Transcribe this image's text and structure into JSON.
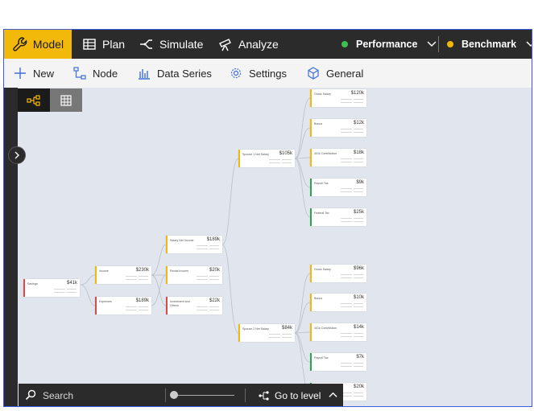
{
  "topbar": {
    "tabs": [
      {
        "label": "Model",
        "icon": "wrench-icon"
      },
      {
        "label": "Plan",
        "icon": "table-icon"
      },
      {
        "label": "Simulate",
        "icon": "branch-icon"
      },
      {
        "label": "Analyze",
        "icon": "telescope-icon"
      }
    ],
    "active_tab": "Model",
    "scenarios": [
      {
        "label": "Performance",
        "color": "#3fbf4f"
      },
      {
        "label": "Benchmark",
        "color": "#f2b90b"
      }
    ]
  },
  "toolbar": {
    "new_label": "New",
    "node_label": "Node",
    "data_series_label": "Data Series",
    "settings_label": "Settings",
    "general_label": "General"
  },
  "nodes": {
    "savings": {
      "label": "Savings",
      "value": "$41k"
    },
    "income": {
      "label": "Income",
      "value": "$230k"
    },
    "expenses": {
      "label": "Expenses",
      "value": "$189k"
    },
    "salary_net_income": {
      "label": "Salary Net Income",
      "value": "$189k"
    },
    "rental_income": {
      "label": "Rental Income",
      "value": "$20k"
    },
    "investment_other": {
      "label": "Investment and Others",
      "value": "$22k"
    },
    "spouse1_net_salary": {
      "label": "Spouse 1 Net Salary",
      "value": "$105k"
    },
    "spouse2_net_salary": {
      "label": "Spouse 2 Net Salary",
      "value": "$84k"
    },
    "s1_gross": {
      "label": "Gross Salary",
      "value": "$120k"
    },
    "s1_bonus": {
      "label": "Bonus",
      "value": "$12k"
    },
    "s1_401k": {
      "label": "401k Contribution",
      "value": "$18k"
    },
    "s1_payroll": {
      "label": "Payroll Tax",
      "value": "$9k"
    },
    "s1_federal": {
      "label": "Federal Tax",
      "value": "$25k"
    },
    "s2_gross": {
      "label": "Gross Salary",
      "value": "$96k"
    },
    "s2_bonus": {
      "label": "Bonus",
      "value": "$10k"
    },
    "s2_401k": {
      "label": "401k Contribution",
      "value": "$14k"
    },
    "s2_payroll": {
      "label": "Payroll Tax",
      "value": "$7k"
    },
    "s2_federal": {
      "label": "",
      "value": "$20k"
    }
  },
  "bottombar": {
    "search_placeholder": "Search",
    "go_to_level_label": "Go to level"
  }
}
